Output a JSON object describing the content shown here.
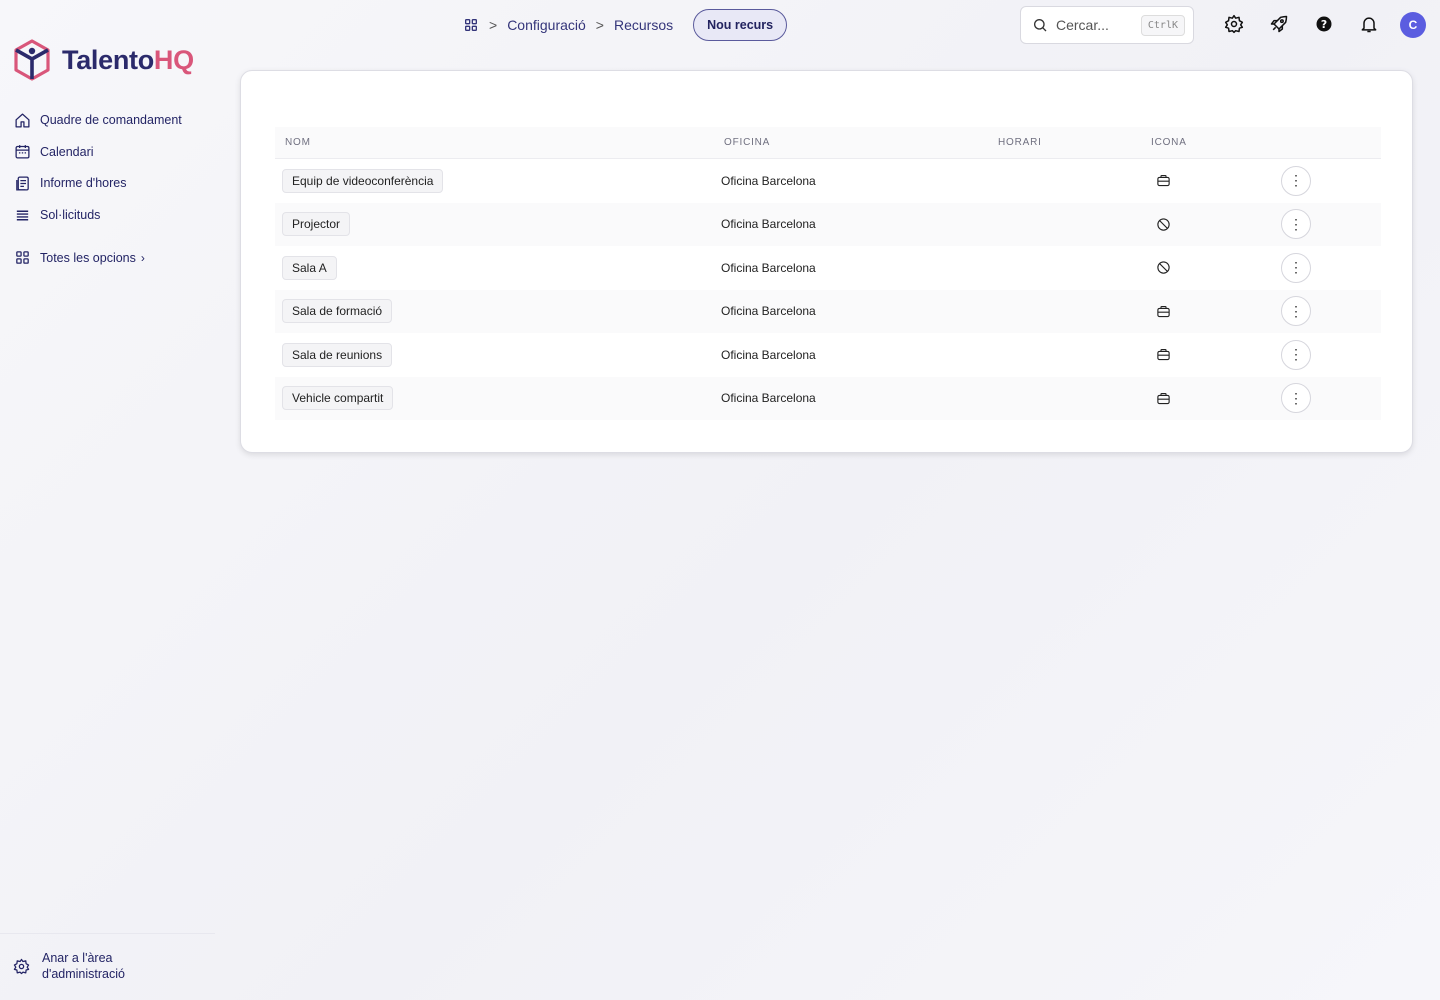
{
  "brand": {
    "name_part1": "Talento",
    "name_part2": "HQ",
    "accent": "#d9567a",
    "primary": "#2b2a6b"
  },
  "sidebar": {
    "items": [
      {
        "label": "Quadre de comandament",
        "icon": "home-icon"
      },
      {
        "label": "Calendari",
        "icon": "calendar-icon"
      },
      {
        "label": "Informe d'hores",
        "icon": "report-icon"
      },
      {
        "label": "Sol·licituds",
        "icon": "list-icon"
      }
    ],
    "all_options": {
      "label": "Totes les opcions",
      "icon": "grid-icon",
      "chevron": "›"
    },
    "admin": {
      "label_line1": "Anar a l'àrea",
      "label_line2": "d'administració",
      "icon": "gear-icon"
    }
  },
  "breadcrumb": {
    "items": [
      "Configuració",
      "Recursos"
    ],
    "separator": ">",
    "action": "Nou recurs"
  },
  "search": {
    "placeholder": "Cercar...",
    "shortcut": "CtrlK"
  },
  "avatar": {
    "initial": "C",
    "color": "#5b5de0"
  },
  "table": {
    "headers": {
      "nom": "NOM",
      "oficina": "OFICINA",
      "horari": "HORARI",
      "icona": "ICONA"
    },
    "rows": [
      {
        "nom": "Equip de videoconferència",
        "oficina": "Oficina Barcelona",
        "horari": "",
        "icon": "briefcase-icon"
      },
      {
        "nom": "Projector",
        "oficina": "Oficina Barcelona",
        "horari": "",
        "icon": "ban-icon"
      },
      {
        "nom": "Sala A",
        "oficina": "Oficina Barcelona",
        "horari": "",
        "icon": "ban-icon"
      },
      {
        "nom": "Sala de formació",
        "oficina": "Oficina Barcelona",
        "horari": "",
        "icon": "briefcase-icon"
      },
      {
        "nom": "Sala de reunions",
        "oficina": "Oficina Barcelona",
        "horari": "",
        "icon": "briefcase-icon"
      },
      {
        "nom": "Vehicle compartit",
        "oficina": "Oficina Barcelona",
        "horari": "",
        "icon": "briefcase-icon"
      }
    ],
    "row_action": "⋮"
  }
}
